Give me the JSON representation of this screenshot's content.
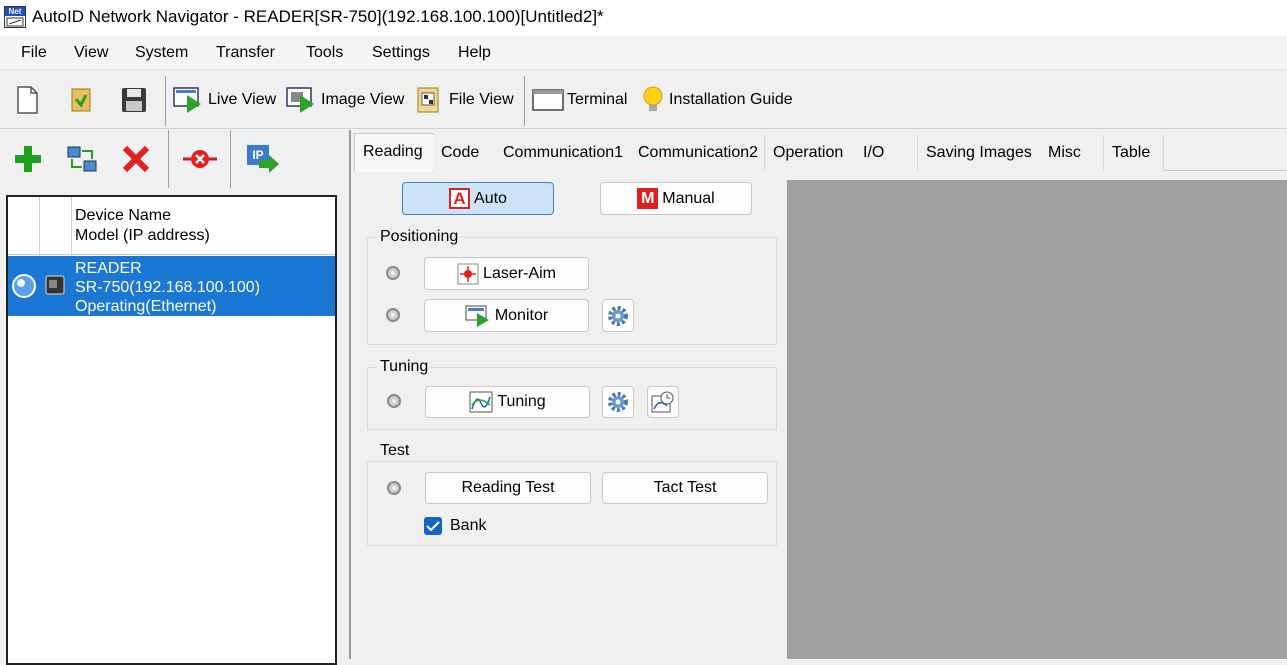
{
  "window": {
    "title": "AutoID Network Navigator - READER[SR-750](192.168.100.100)[Untitled2]*",
    "app_icon_label": "Net"
  },
  "menu": [
    "File",
    "View",
    "System",
    "Transfer",
    "Tools",
    "Settings",
    "Help"
  ],
  "toolbar": {
    "new_icon": "new-file-icon",
    "open_icon": "open-file-icon",
    "save_icon": "save-icon",
    "live_view": "Live View",
    "image_view": "Image View",
    "file_view": "File View",
    "terminal": "Terminal",
    "installation_guide": "Installation Guide"
  },
  "left_toolbar": {
    "add_icon": "add-icon",
    "network_icon": "network-icon",
    "delete_icon": "delete-icon",
    "disconnect_icon": "disconnect-icon",
    "ip_label": "IP"
  },
  "device_list": {
    "header_line1": "Device Name",
    "header_line2": "Model (IP address)",
    "rows": [
      {
        "name": "READER",
        "model": "SR-750(192.168.100.100)",
        "status": "Operating(Ethernet)"
      }
    ]
  },
  "tabs": [
    "Reading",
    "Code",
    "Communication1",
    "Communication2",
    "Operation",
    "I/O",
    "Saving Images",
    "Misc",
    "Table"
  ],
  "active_tab": "Reading",
  "reading": {
    "auto_label": "Auto",
    "auto_badge": "A",
    "manual_label": "Manual",
    "manual_badge": "M",
    "positioning": {
      "title": "Positioning",
      "laser_aim": "Laser-Aim",
      "monitor": "Monitor"
    },
    "tuning": {
      "title": "Tuning",
      "tuning_button": "Tuning"
    },
    "test": {
      "title": "Test",
      "reading_test": "Reading Test",
      "tact_test": "Tact Test",
      "bank_label": "Bank",
      "bank_checked": true
    }
  },
  "colors": {
    "selection_blue": "#1a78d4",
    "auto_selected_bg": "#cde3f7",
    "badge_red": "#e02020",
    "gray_area": "#a0a0a0"
  }
}
